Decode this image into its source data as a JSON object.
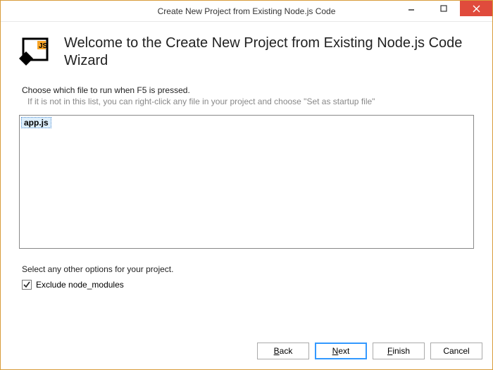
{
  "window": {
    "title": "Create New Project from Existing Node.js Code"
  },
  "header": {
    "heading": "Welcome to the Create New Project from Existing Node.js Code Wizard"
  },
  "instructions": {
    "main": "Choose which file to run when F5 is pressed.",
    "sub": "If it is not in this list, you can right-click any file in your project and choose \"Set as startup file\""
  },
  "file_list": {
    "items": [
      "app.js"
    ],
    "selected_index": 0
  },
  "options": {
    "label": "Select any other options for your project.",
    "exclude_node_modules": {
      "label": "Exclude node_modules",
      "checked": true
    }
  },
  "buttons": {
    "back": "Back",
    "next": "Next",
    "finish": "Finish",
    "cancel": "Cancel"
  },
  "win_controls": {
    "minimize": "–",
    "maximize": "▢",
    "close": "✕"
  }
}
